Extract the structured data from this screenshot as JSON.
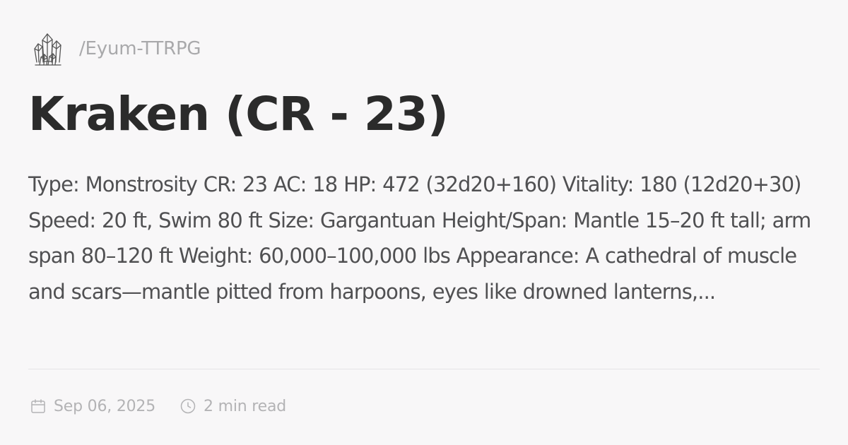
{
  "site": {
    "logo_icon": "crystal-cluster-icon",
    "path": "/Eyum-TTRPG"
  },
  "article": {
    "title": "Kraken (CR - 23)",
    "excerpt": "Type: Monstrosity CR: 23 AC: 18 HP: 472 (32d20+160) Vitality: 180 (12d20+30) Speed: 20 ft, Swim 80 ft Size: Gargantuan Height/Span: Mantle 15–20 ft tall; arm span 80–120 ft Weight: 60,000–100,000 lbs Appearance: A cathedral of muscle and scars—mantle pitted from harpoons, eyes like drowned lanterns,..."
  },
  "meta": {
    "date_icon": "calendar-icon",
    "date": "Sep 06, 2025",
    "read_time_icon": "clock-icon",
    "read_time": "2 min read"
  },
  "colors": {
    "background": "#f8f7f8",
    "title": "#2b2b2b",
    "body_text": "#505052",
    "muted": "#a9a9ab",
    "divider": "#e5e4e6"
  }
}
